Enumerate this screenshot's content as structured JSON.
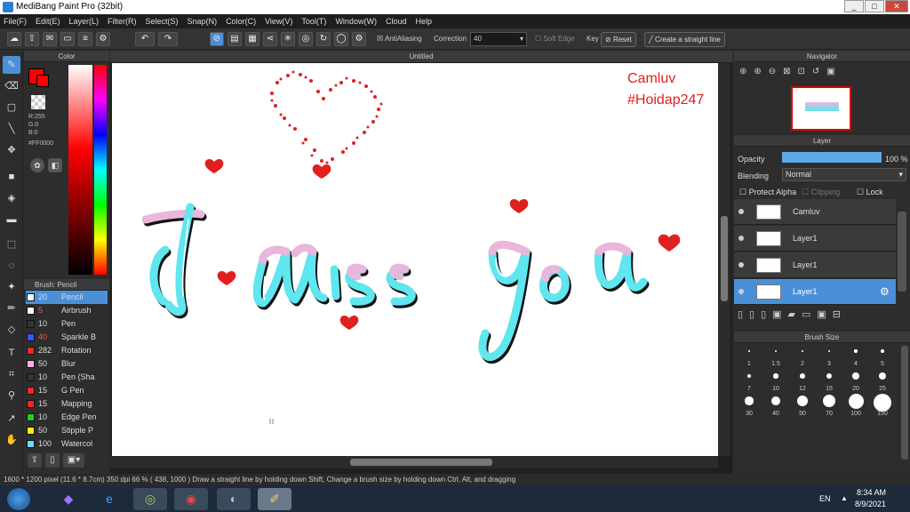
{
  "title": "MediBang Paint Pro (32bit)",
  "window_controls": {
    "minimize": "_",
    "maximize": "□",
    "close": "✕"
  },
  "menu": [
    "File(F)",
    "Edit(E)",
    "Layer(L)",
    "Filter(R)",
    "Select(S)",
    "Snap(N)",
    "Color(C)",
    "View(V)",
    "Tool(T)",
    "Window(W)",
    "Cloud",
    "Help"
  ],
  "toolbar": {
    "antialiasing": "AntiAliasing",
    "correction_label": "Correction",
    "correction_value": "40",
    "soft_edge": "Soft Edge",
    "key_label": "Key",
    "reset": "Reset",
    "straight_line": "Create a straight line"
  },
  "color_panel": {
    "title": "Color",
    "r": "R:255",
    "g": "G:0",
    "b": "B:0",
    "hex": "#FF0000",
    "main_color": "#ff0000"
  },
  "brush_panel": {
    "title": "Brush: Pencil",
    "items": [
      {
        "size": "20",
        "name": "Pencil",
        "color": "#ffffff"
      },
      {
        "size": "5",
        "name": "Airbrush",
        "color": "#ffffff"
      },
      {
        "size": "10",
        "name": "Pen",
        "color": "#333333"
      },
      {
        "size": "40",
        "name": "Sparkle B",
        "color": "#3355ff"
      },
      {
        "size": "282",
        "name": "Rotation",
        "color": "#ff2222"
      },
      {
        "size": "50",
        "name": "Blur",
        "color": "#ffb0e8"
      },
      {
        "size": "10",
        "name": "Pen (Sha",
        "color": "#333333"
      },
      {
        "size": "15",
        "name": "G Pen",
        "color": "#ff2222"
      },
      {
        "size": "15",
        "name": "Mapping",
        "color": "#ff2222"
      },
      {
        "size": "10",
        "name": "Edge Pen",
        "color": "#22cc22"
      },
      {
        "size": "50",
        "name": "Stipple P",
        "color": "#ffee00"
      },
      {
        "size": "100",
        "name": "Watercol",
        "color": "#66ddff"
      }
    ]
  },
  "document": {
    "tab": "Untitled",
    "watermark_name": "Camluv",
    "watermark_tag": "#Hoidap247"
  },
  "navigator": {
    "title": "Navigator"
  },
  "layer_panel": {
    "title": "Layer",
    "opacity_label": "Opacity",
    "opacity_value": "100 %",
    "blending_label": "Blending",
    "blending_value": "Normal",
    "protect_alpha": "Protect Alpha",
    "clipping": "Clipping",
    "lock": "Lock",
    "layers": [
      {
        "name": "Camluv",
        "selected": false
      },
      {
        "name": "Layer1",
        "selected": false
      },
      {
        "name": "Layer1",
        "selected": false
      },
      {
        "name": "Layer1",
        "selected": true
      }
    ]
  },
  "brush_size_panel": {
    "title": "Brush Size",
    "sizes": [
      "1",
      "1.5",
      "2",
      "3",
      "4",
      "5",
      "7",
      "10",
      "12",
      "15",
      "20",
      "25",
      "30",
      "40",
      "50",
      "70",
      "100",
      "150"
    ]
  },
  "status": "1600 * 1200 pixel  (11.6 * 8.7cm)  350 dpi  66 %  ( 438, 1000 )  Draw a straight line by holding down Shift, Change a brush size by holding down Ctrl, Alt, and dragging",
  "taskbar": {
    "lang": "EN",
    "time": "8:34 AM",
    "date": "8/9/2021"
  }
}
